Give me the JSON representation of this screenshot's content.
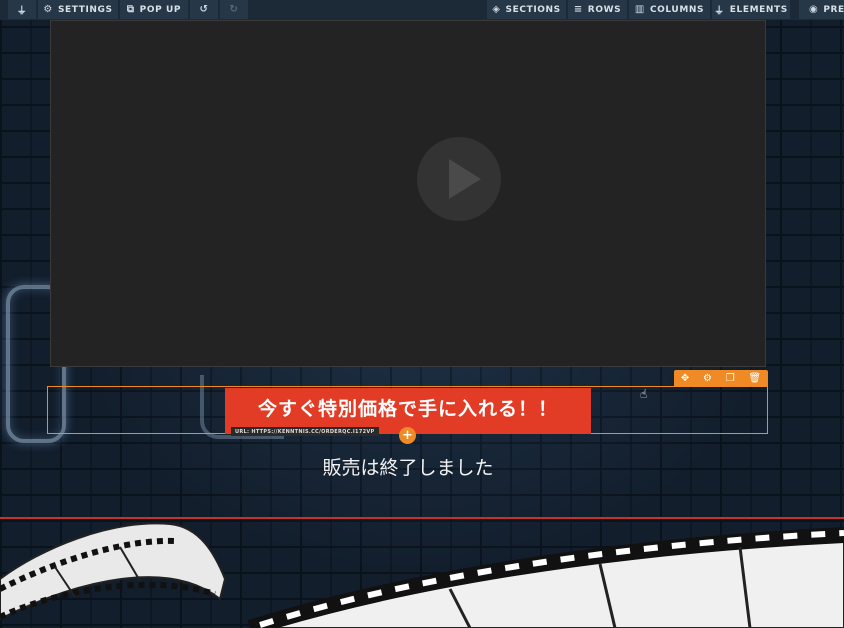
{
  "toolbar": {
    "left": [
      {
        "icon": "plug-icon",
        "glyph": "⏚",
        "label": ""
      },
      {
        "icon": "gears-icon",
        "glyph": "⚙",
        "label": "SETTINGS"
      },
      {
        "icon": "external-link-icon",
        "glyph": "⧉",
        "label": "POP UP"
      },
      {
        "icon": "undo-icon",
        "glyph": "↺",
        "label": ""
      },
      {
        "icon": "redo-icon",
        "glyph": "↻",
        "label": ""
      }
    ],
    "right": [
      {
        "icon": "cube-icon",
        "glyph": "◈",
        "label": "SECTIONS"
      },
      {
        "icon": "bars-icon",
        "glyph": "≡",
        "label": "ROWS"
      },
      {
        "icon": "columns-icon",
        "glyph": "▥",
        "label": "COLUMNS"
      },
      {
        "icon": "plug-icon",
        "glyph": "⏚",
        "label": "ELEMENTS"
      },
      {
        "icon": "eye-icon",
        "glyph": "◉",
        "label": "PREV"
      }
    ]
  },
  "row_tools": [
    {
      "icon": "move-icon",
      "glyph": "✥"
    },
    {
      "icon": "gear-icon",
      "glyph": "⚙"
    },
    {
      "icon": "copy-icon",
      "glyph": "❐"
    },
    {
      "icon": "trash-icon",
      "glyph": "🗑"
    }
  ],
  "cta": {
    "label": "今すぐ特別価格で手に入れる！！",
    "url": "URL: HTTPS://KENNTNIS.CC/ORDERQC.I172VP"
  },
  "sold_out_text": "販売は終了しました",
  "colors": {
    "accent": "#f08a24",
    "cta": "#e23b26",
    "toolbar": "#263747",
    "divider": "#c2332a"
  }
}
